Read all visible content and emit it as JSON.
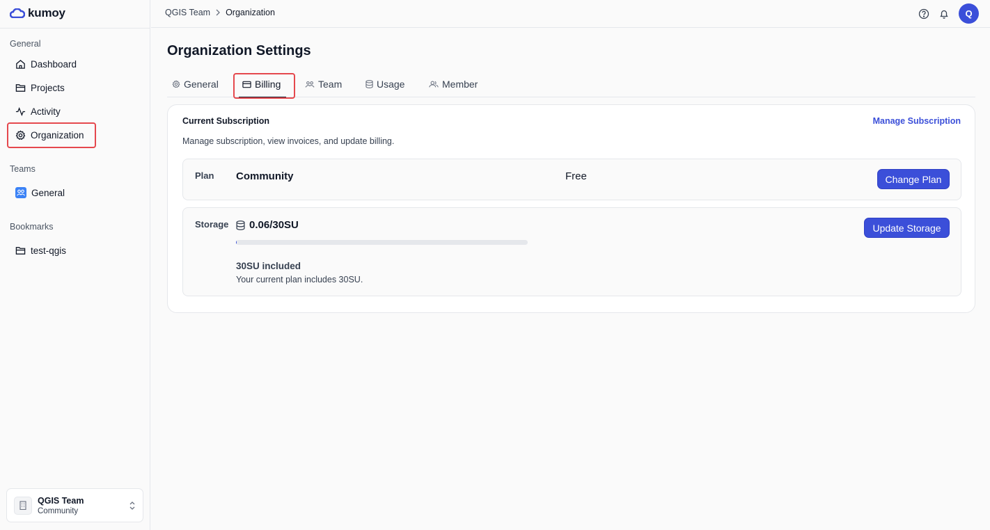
{
  "app": {
    "logo_text": "kumoy"
  },
  "sidebar": {
    "sections": {
      "general": "General",
      "teams": "Teams",
      "bookmarks": "Bookmarks"
    },
    "general_items": [
      {
        "label": "Dashboard",
        "icon": "home-icon"
      },
      {
        "label": "Projects",
        "icon": "folder-icon"
      },
      {
        "label": "Activity",
        "icon": "activity-icon"
      },
      {
        "label": "Organization",
        "icon": "gear-icon"
      }
    ],
    "team_items": [
      {
        "label": "General",
        "icon": "team-icon"
      }
    ],
    "bookmark_items": [
      {
        "label": "test-qgis",
        "icon": "folder-icon"
      }
    ],
    "team_switcher": {
      "name": "QGIS Team",
      "plan": "Community"
    }
  },
  "header": {
    "breadcrumb": [
      "QGIS Team",
      "Organization"
    ],
    "avatar_letter": "Q"
  },
  "main": {
    "title": "Organization Settings",
    "tabs": [
      {
        "label": "General",
        "icon": "gear-icon"
      },
      {
        "label": "Billing",
        "icon": "credit-card-icon",
        "active": true
      },
      {
        "label": "Team",
        "icon": "team-icon"
      },
      {
        "label": "Usage",
        "icon": "database-icon"
      },
      {
        "label": "Member",
        "icon": "users-icon"
      }
    ],
    "subscription": {
      "title": "Current Subscription",
      "manage_link": "Manage Subscription",
      "description": "Manage subscription, view invoices, and update billing.",
      "plan": {
        "label": "Plan",
        "name": "Community",
        "price": "Free",
        "button": "Change Plan"
      },
      "storage": {
        "label": "Storage",
        "value": "0.06/30SU",
        "used_fraction": 0.002,
        "button": "Update Storage",
        "included_title": "30SU included",
        "included_desc": "Your current plan includes 30SU."
      }
    }
  },
  "colors": {
    "accent": "#3b4fd9",
    "highlight": "#e5484d"
  }
}
